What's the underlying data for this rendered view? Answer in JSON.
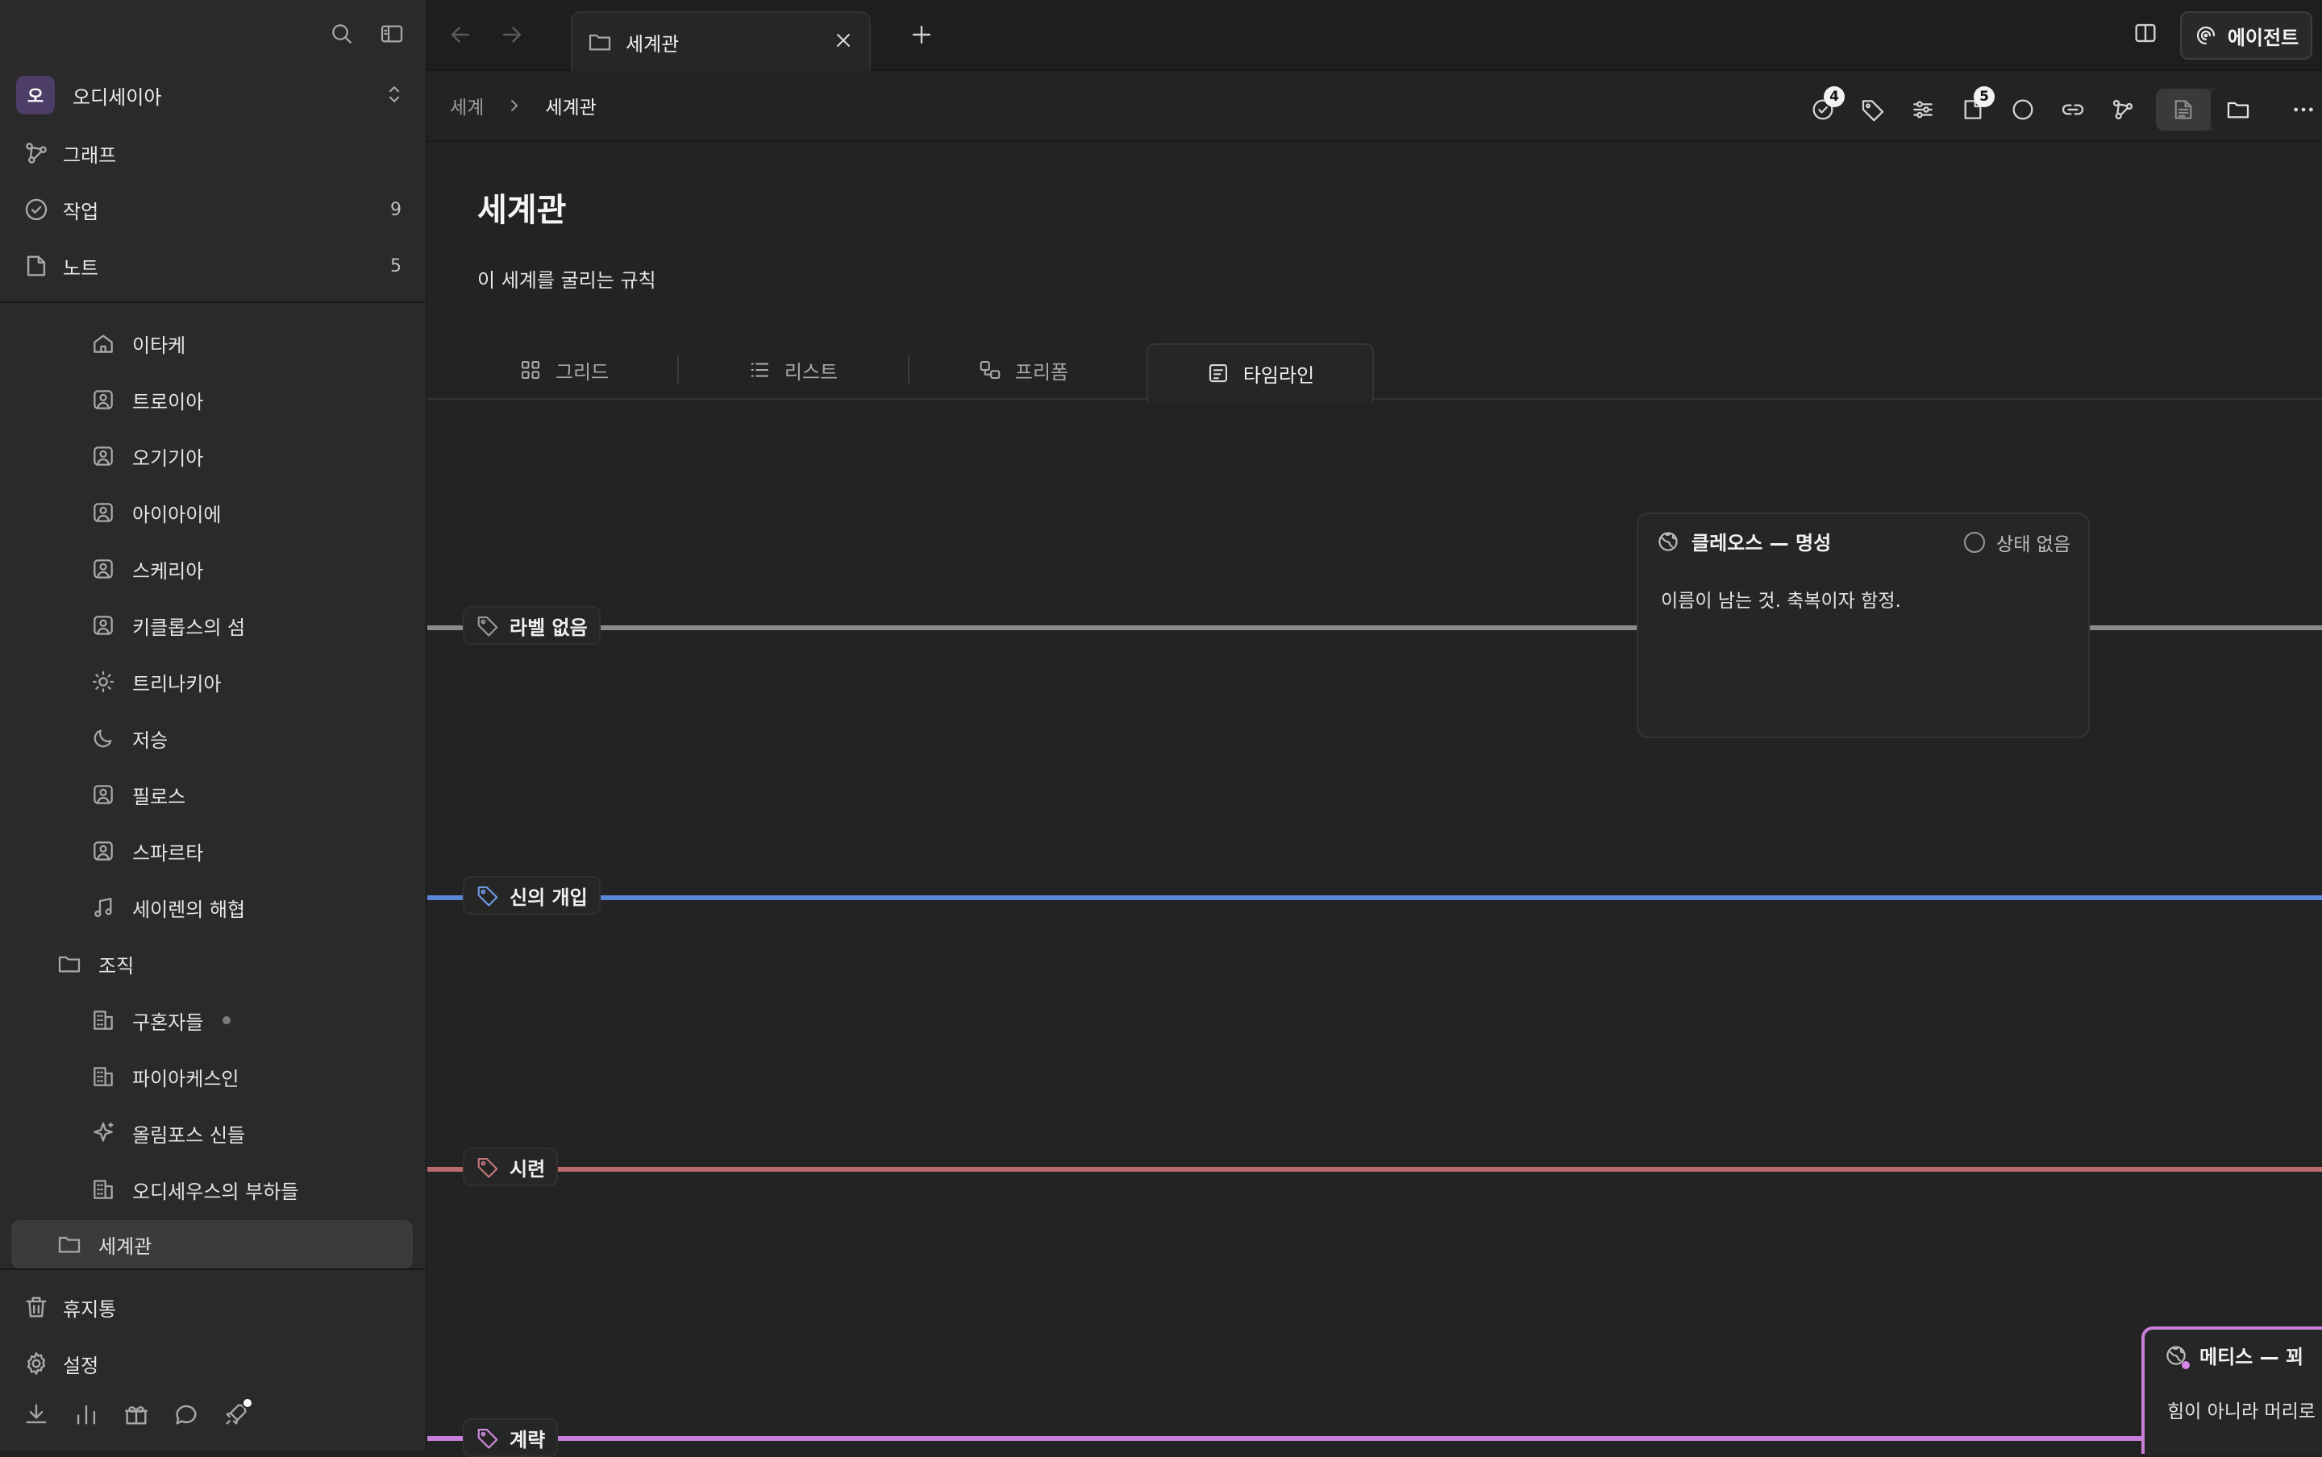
{
  "workspace": {
    "avatar_text": "오",
    "name": "오디세이아"
  },
  "sidebar": {
    "nav": [
      {
        "label": "그래프",
        "count": ""
      },
      {
        "label": "작업",
        "count": "9"
      },
      {
        "label": "노트",
        "count": "5"
      }
    ],
    "tree": [
      {
        "label": "이타케",
        "icon": "home-icon"
      },
      {
        "label": "트로이아",
        "icon": "location-icon"
      },
      {
        "label": "오기기아",
        "icon": "location-icon"
      },
      {
        "label": "아이아이에",
        "icon": "location-icon"
      },
      {
        "label": "스케리아",
        "icon": "location-icon"
      },
      {
        "label": "키클롭스의 섬",
        "icon": "location-icon"
      },
      {
        "label": "트리나키아",
        "icon": "sun-icon"
      },
      {
        "label": "저승",
        "icon": "moon-icon"
      },
      {
        "label": "필로스",
        "icon": "location-icon"
      },
      {
        "label": "스파르타",
        "icon": "location-icon"
      },
      {
        "label": "세이렌의 해협",
        "icon": "music-icon"
      },
      {
        "label": "조직",
        "icon": "folder-icon"
      },
      {
        "label": "구혼자들",
        "icon": "building-icon"
      },
      {
        "label": "파이아케스인",
        "icon": "building-icon"
      },
      {
        "label": "올림포스 신들",
        "icon": "sparkle-icon"
      },
      {
        "label": "오디세우스의 부하들",
        "icon": "building-icon"
      },
      {
        "label": "세계관",
        "icon": "folder-icon"
      }
    ],
    "bottom": [
      {
        "label": "휴지통"
      },
      {
        "label": "설정"
      }
    ]
  },
  "topbar": {
    "tab_label": "세계관",
    "agent_label": "에이전트"
  },
  "docbar": {
    "breadcrumb": [
      "세계",
      "세계관"
    ],
    "task_badge": "4",
    "notes_badge": "5"
  },
  "page": {
    "title": "세계관",
    "description": "이 세계를 굴리는 규칙",
    "view_tabs": [
      "그리드",
      "리스트",
      "프리폼",
      "타임라인"
    ],
    "active_view": "타임라인"
  },
  "timeline": {
    "lanes": [
      {
        "label": "라벨 없음",
        "color": "#8a8a8a"
      },
      {
        "label": "신의 개입",
        "color": "#5a86d6"
      },
      {
        "label": "시련",
        "color": "#b96a6a"
      },
      {
        "label": "계략",
        "color": "#c77fd9"
      }
    ],
    "cards": [
      {
        "title": "클레오스 — 명성",
        "status": "상태 없음",
        "body": "이름이 남는 것. 축복이자 함정."
      },
      {
        "title": "메티스 — 꾀",
        "status": "",
        "body": "힘이 아니라 머리로"
      }
    ]
  },
  "colors": {
    "accent": "#4c3e66",
    "background": "#232323",
    "sidebar": "#2a2a2a"
  }
}
